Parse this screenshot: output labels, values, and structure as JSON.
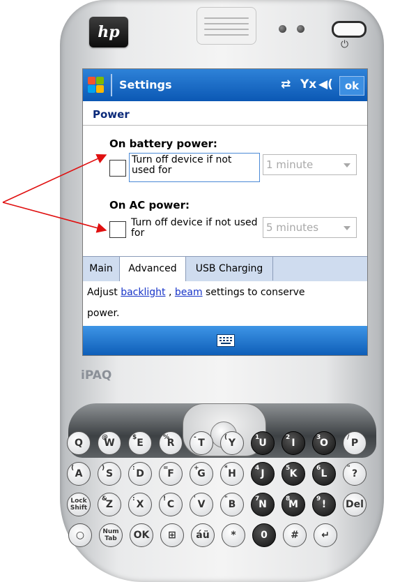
{
  "device": {
    "brand": "hp",
    "model_label": "iPAQ",
    "power_symbol": "⏻"
  },
  "titlebar": {
    "title": "Settings",
    "ok_label": "ok",
    "connectivity_icon": "⇄",
    "signal_icon": "Yx",
    "volume_icon": "◀("
  },
  "page": {
    "title": "Power"
  },
  "battery": {
    "heading": "On battery power:",
    "checkbox_label": "Turn off device if not used for",
    "checked": false,
    "dropdown_value": "1 minute"
  },
  "ac": {
    "heading": "On AC power:",
    "checkbox_label": "Turn off device if not used for",
    "checked": false,
    "dropdown_value": "5 minutes"
  },
  "tabs": [
    {
      "label": "Main",
      "active": false
    },
    {
      "label": "Advanced",
      "active": true
    },
    {
      "label": "USB Charging",
      "active": false
    }
  ],
  "description": {
    "prefix": "Adjust ",
    "link1": "backlight",
    "sep": " , ",
    "link2": "beam",
    "suffix": "  settings to conserve",
    "line2": "power."
  },
  "keyboard": {
    "rows": [
      [
        {
          "t": "Q",
          "s": ""
        },
        {
          "t": "W",
          "s": "@"
        },
        {
          "t": "E",
          "s": "$"
        },
        {
          "t": "R",
          "s": "%"
        },
        {
          "t": "T",
          "s": "-"
        },
        {
          "t": "Y",
          "s": "("
        },
        {
          "t": "U",
          "s": "1"
        },
        {
          "t": "I",
          "s": "2"
        },
        {
          "t": "O",
          "s": "3"
        },
        {
          "t": "P",
          "s": "/"
        }
      ],
      [
        {
          "t": "A",
          "s": "("
        },
        {
          "t": "S",
          "s": ")"
        },
        {
          "t": "D",
          "s": ":"
        },
        {
          "t": "F",
          "s": "="
        },
        {
          "t": "G",
          "s": "+"
        },
        {
          "t": "H",
          "s": "*"
        },
        {
          "t": "J",
          "s": "4"
        },
        {
          "t": "K",
          "s": "5"
        },
        {
          "t": "L",
          "s": "6"
        },
        {
          "t": "?",
          "s": "\""
        }
      ],
      [
        {
          "t": "Lock\nShift",
          "s": ""
        },
        {
          "t": "Z",
          "s": "&"
        },
        {
          "t": "X",
          "s": ":"
        },
        {
          "t": "C",
          "s": "!"
        },
        {
          "t": "V",
          "s": "'"
        },
        {
          "t": "B",
          "s": "\""
        },
        {
          "t": "N",
          "s": "7"
        },
        {
          "t": "M",
          "s": "8"
        },
        {
          "t": "!",
          "s": "9"
        },
        {
          "t": "Del",
          "s": ""
        }
      ],
      [
        {
          "t": "○",
          "s": ""
        },
        {
          "t": "Num\nTab",
          "s": ""
        },
        {
          "t": "OK",
          "s": ""
        },
        {
          "t": "⊞",
          "s": ""
        },
        {
          "t": "áü",
          "s": ""
        },
        {
          "t": "*",
          "s": ""
        },
        {
          "t": "0",
          "s": ""
        },
        {
          "t": "#",
          "s": ""
        },
        {
          "t": "↵",
          "s": ""
        }
      ]
    ]
  },
  "colors": {
    "titlebar": "#0b58b4",
    "link": "#1633c8",
    "annotation_arrow": "#e01010"
  }
}
